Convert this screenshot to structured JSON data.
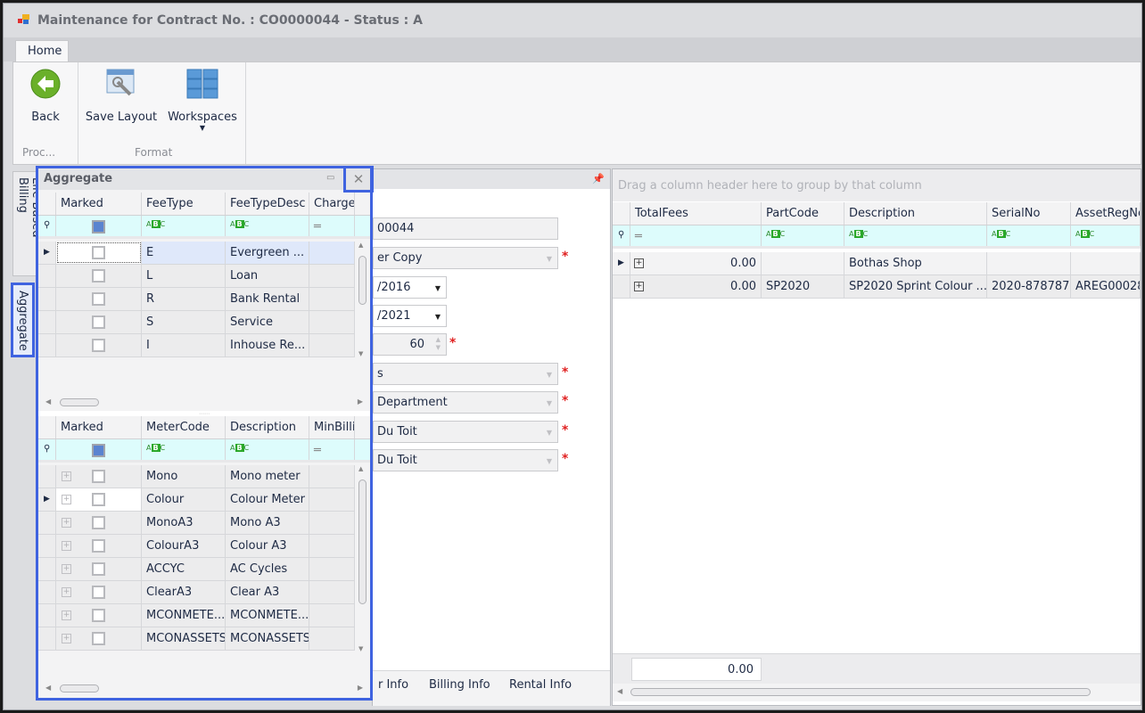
{
  "window": {
    "title": "Maintenance for Contract No. : CO0000044 - Status : A"
  },
  "ribbon": {
    "tab": "Home",
    "back": "Back",
    "save_layout": "Save Layout",
    "workspaces": "Workspaces",
    "group_process": "Proc...",
    "group_format": "Format"
  },
  "side_tabs": [
    "Life Based Billing",
    "Aggregate"
  ],
  "aggregate": {
    "title": "Aggregate",
    "fees": {
      "columns": [
        "Marked",
        "FeeType",
        "FeeTypeDesc",
        "ChargeAm"
      ],
      "rows": [
        {
          "type": "E",
          "desc": "Evergreen ..."
        },
        {
          "type": "L",
          "desc": "Loan"
        },
        {
          "type": "R",
          "desc": "Bank Rental"
        },
        {
          "type": "S",
          "desc": "Service"
        },
        {
          "type": "I",
          "desc": "Inhouse Re..."
        }
      ]
    },
    "meters": {
      "columns": [
        "Marked",
        "MeterCode",
        "Description",
        "MinBilling"
      ],
      "rows": [
        {
          "code": "Mono",
          "desc": "Mono meter"
        },
        {
          "code": "Colour",
          "desc": "Colour Meter"
        },
        {
          "code": "MonoA3",
          "desc": "Mono A3"
        },
        {
          "code": "ColourA3",
          "desc": "Colour A3"
        },
        {
          "code": "ACCYC",
          "desc": "AC Cycles"
        },
        {
          "code": "ClearA3",
          "desc": "Clear A3"
        },
        {
          "code": "MCONMETE...",
          "desc": "MCONMETE..."
        },
        {
          "code": "MCONASSETS",
          "desc": "MCONASSETS"
        }
      ]
    }
  },
  "form": {
    "contract_no": "00044",
    "billing_type": "er Copy",
    "start_date": "/2016",
    "end_date": "/2021",
    "months": "60",
    "field6": "s",
    "department": "Department",
    "person1": "Du Toit",
    "person2": "Du Toit",
    "tabs": [
      "r Info",
      "Billing Info",
      "Rental Info"
    ]
  },
  "assets": {
    "group_hint": "Drag a column header here to group by that column",
    "columns": [
      "TotalFees",
      "PartCode",
      "Description",
      "SerialNo",
      "AssetRegNo"
    ],
    "rows": [
      {
        "total": "0.00",
        "part": "",
        "desc": "Bothas Shop",
        "serial": "",
        "asset": ""
      },
      {
        "total": "0.00",
        "part": "SP2020",
        "desc": "SP2020 Sprint Colour ...",
        "serial": "2020-878787",
        "asset": "AREG00028"
      }
    ],
    "footer_total": "0.00"
  },
  "colors": {
    "highlight": "#3f63e0",
    "filter_row": "#ddfcfc"
  }
}
